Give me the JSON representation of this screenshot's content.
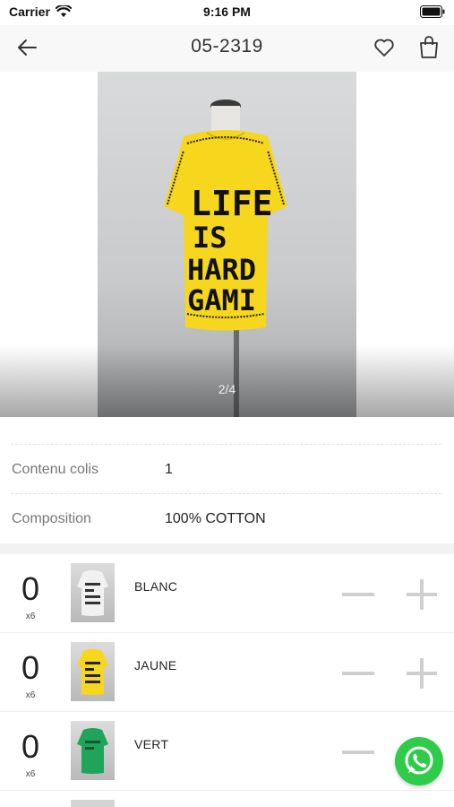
{
  "status_bar": {
    "carrier": "Carrier",
    "time": "9:16 PM",
    "wifi_icon": "wifi-icon",
    "battery_icon": "battery-icon"
  },
  "nav": {
    "title": "05-2319",
    "back_icon": "arrow-left-icon",
    "favorite_icon": "heart-icon",
    "bag_icon": "shopping-bag-icon"
  },
  "gallery": {
    "page_indicator": "2/4",
    "main_image": {
      "shirt_color": "#f6d71e",
      "print_lines": [
        "LIFE",
        "IS",
        "HARD",
        "GAMI"
      ]
    }
  },
  "details": [
    {
      "label": "Contenu colis",
      "value": "1"
    },
    {
      "label": "Composition",
      "value": "100% COTTON"
    }
  ],
  "variants": [
    {
      "quantity": "0",
      "pack": "x6",
      "color_name": "BLANC",
      "thumb_color": "#f1f1f1"
    },
    {
      "quantity": "0",
      "pack": "x6",
      "color_name": "JAUNE",
      "thumb_color": "#f6d71e"
    },
    {
      "quantity": "0",
      "pack": "x6",
      "color_name": "VERT",
      "thumb_color": "#1fa45a"
    }
  ],
  "colors": {
    "whatsapp_green": "#2ecc4a",
    "control_gray": "#cfcfcf"
  }
}
